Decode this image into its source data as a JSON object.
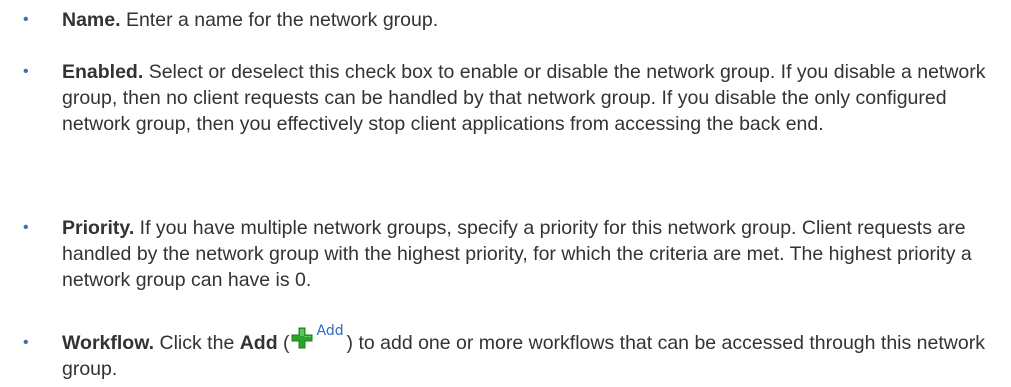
{
  "items": [
    {
      "term": "Name.",
      "text": " Enter a name for the network group."
    },
    {
      "term": "Enabled.",
      "text": " Select or deselect this check box to enable or disable the network group. If you disable a network group, then no client requests can be handled by that network group. If you disable the only configured network group, then you effectively stop client applications from accessing the back end."
    },
    {
      "term": "Priority.",
      "text": " If you have multiple network groups, specify a priority for this network group. Client requests are handled by the network group with the highest priority, for which the criteria are met. The highest priority a network group can have is 0."
    },
    {
      "term": "Workflow.",
      "text_before": " Click the ",
      "bold_inline": "Add",
      "paren_open": " (",
      "icon_label": "Add",
      "text_after": ") to add one or more workflows that can be accessed through this network group."
    }
  ],
  "bullet_glyph": "•",
  "icon": "green-plus-add-icon",
  "colors": {
    "text": "#333333",
    "bullet": "#3a6fb0",
    "plus_icon": "#2aa52a",
    "icon_label": "#2f68c8"
  }
}
